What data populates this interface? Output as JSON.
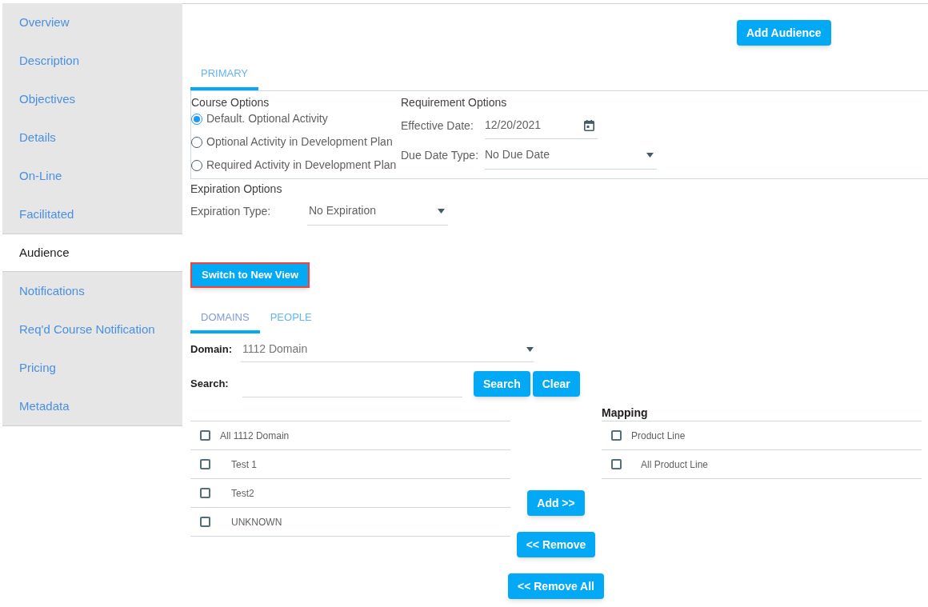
{
  "sidebar": {
    "items": [
      {
        "label": "Overview",
        "selected": false
      },
      {
        "label": "Description",
        "selected": false
      },
      {
        "label": "Objectives",
        "selected": false
      },
      {
        "label": "Details",
        "selected": false
      },
      {
        "label": "On-Line",
        "selected": false
      },
      {
        "label": "Facilitated",
        "selected": false
      },
      {
        "label": "Audience",
        "selected": true
      },
      {
        "label": "Notifications",
        "selected": false
      },
      {
        "label": "Req'd Course Notification",
        "selected": false
      },
      {
        "label": "Pricing",
        "selected": false
      },
      {
        "label": "Metadata",
        "selected": false
      }
    ]
  },
  "add_audience_button": "Add Audience",
  "primary_tabs": [
    {
      "label": "PRIMARY",
      "selected": true
    }
  ],
  "course_options": {
    "title": "Course Options",
    "options": [
      {
        "label": "Default. Optional Activity",
        "selected": true
      },
      {
        "label": "Optional Activity in Development Plan",
        "selected": false
      },
      {
        "label": "Required Activity in Development Plan",
        "selected": false
      }
    ]
  },
  "requirement_options": {
    "title": "Requirement Options",
    "effective_date": {
      "label": "Effective Date:",
      "value": "12/20/2021"
    },
    "due_date_type": {
      "label": "Due Date Type:",
      "value": "No Due Date"
    }
  },
  "expiration_options": {
    "title": "Expiration Options",
    "expiration_type": {
      "label": "Expiration Type:",
      "value": "No Expiration"
    }
  },
  "switch_button": "Switch to New View",
  "audience_tabs": [
    {
      "label": "DOMAINS",
      "selected": true
    },
    {
      "label": "PEOPLE",
      "selected": false
    }
  ],
  "domain": {
    "label": "Domain:",
    "value": "1112 Domain"
  },
  "search": {
    "label": "Search:",
    "buttons": [
      "Search",
      "Clear"
    ]
  },
  "available": [
    {
      "label": "All 1112 Domain",
      "checked": false,
      "children": [
        {
          "label": "Test 1",
          "checked": false
        },
        {
          "label": "Test2",
          "checked": false
        },
        {
          "label": "UNKNOWN",
          "checked": false
        }
      ]
    }
  ],
  "transfer_buttons": [
    "Add >>",
    "<< Remove",
    "<< Remove All"
  ],
  "mapping": {
    "title": "Mapping",
    "items": [
      {
        "label": "Product Line",
        "checked": false,
        "children": [
          {
            "label": "All Product Line",
            "checked": false
          }
        ]
      }
    ]
  }
}
